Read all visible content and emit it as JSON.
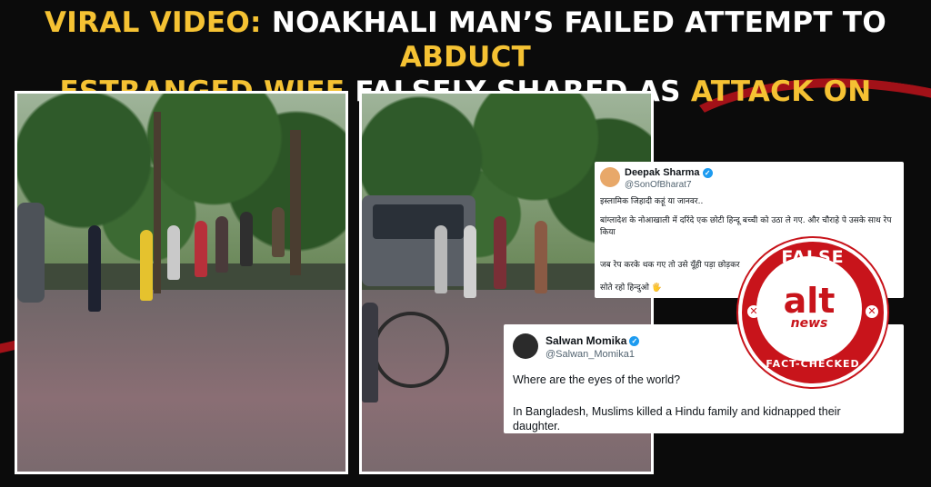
{
  "headline": {
    "line1_a": "VIRAL VIDEO:",
    "line1_b": " NOAKHALI MAN’S FAILED ATTEMPT TO ",
    "line1_c": "ABDUCT",
    "line2_a": "ESTRANGED WIFE",
    "line2_b": " FALSELY SHARED AS ",
    "line2_c": "ATTACK ON HINDUS"
  },
  "colors": {
    "highlight": "#f5c233",
    "accent_red": "#c8141b",
    "verified_blue": "#1d9bf0"
  },
  "tweet1": {
    "name": "Deepak Sharma",
    "handle": "@SonOfBharat7",
    "line1": "इस्लामिक जिहादी कहूं या जानवर..",
    "line2": "बांग्लादेश के नोआखाली में दरिंदे एक छोटी हिन्दू बच्ची को उठा ले गए. और चौराहे पे उसके साथ रेप किया",
    "line3": "जब रेप करके थक गए तो उसे यूँही पड़ा छोड़कर",
    "line4": "सोते रहो हिन्दुओ 🖐"
  },
  "tweet2": {
    "name": "Salwan Momika",
    "handle": "@Salwan_Momika1",
    "line1": "Where are the eyes of the world?",
    "line2": "In Bangladesh, Muslims killed a Hindu family and kidnapped their daughter."
  },
  "badge": {
    "verdict": "FALSE",
    "logo_alt": "alt",
    "logo_news": "news",
    "subtitle": "FACT-CHECKED",
    "icon": "close-icon"
  }
}
